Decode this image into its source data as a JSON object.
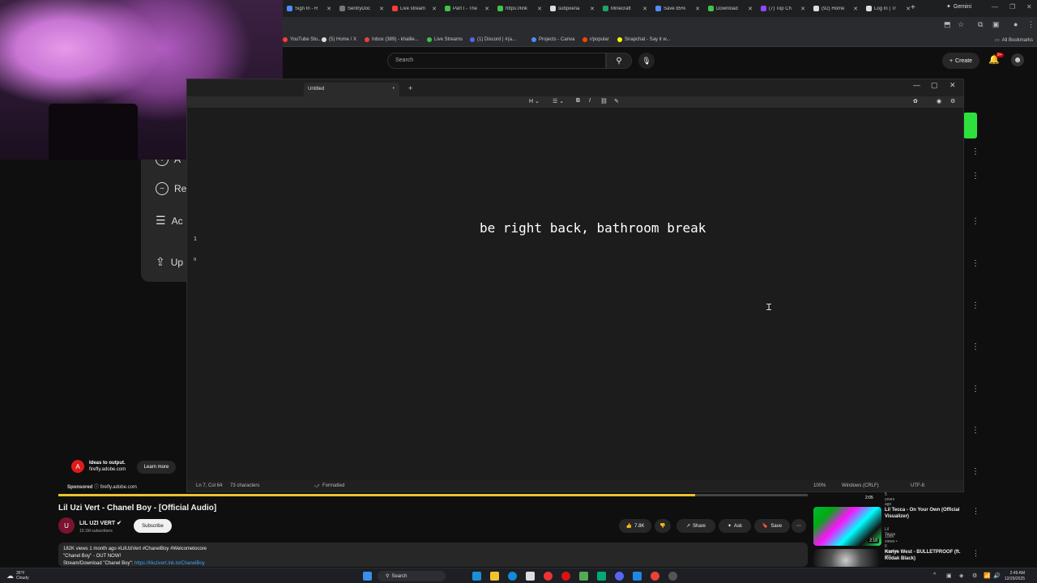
{
  "chrome": {
    "tabs": [
      {
        "label": "Sign In - R",
        "color": "#4f8cff"
      },
      {
        "label": "SentryDoc",
        "color": "#777777"
      },
      {
        "label": "Live stream",
        "color": "#ff3b3b"
      },
      {
        "label": "Part I - The",
        "color": "#3fc24a"
      },
      {
        "label": "https://link",
        "color": "#3fc24a"
      },
      {
        "label": "subpoena",
        "color": "#dddddd"
      },
      {
        "label": "Minecraft",
        "color": "#21a366"
      },
      {
        "label": "Save 85%",
        "color": "#4f8cff"
      },
      {
        "label": "Download",
        "color": "#3fc24a"
      },
      {
        "label": "(7) Top Ch",
        "color": "#9146ff"
      },
      {
        "label": "(92) Home",
        "color": "#dddddd"
      },
      {
        "label": "Log In | Tr",
        "color": "#dddddd"
      }
    ],
    "new_tab": "+",
    "gemini": "Gemini",
    "bookmarks": [
      {
        "label": "YouTube Stu...",
        "color": "#ff3b3b"
      },
      {
        "label": "(5) Home / X",
        "color": "#dddddd"
      },
      {
        "label": "Inbox (389) - khalile...",
        "color": "#ea4335"
      },
      {
        "label": "Live Streams",
        "color": "#3fc24a"
      },
      {
        "label": "(1) Discord | #(a...",
        "color": "#5865f2"
      },
      {
        "label": "Projects - Canva",
        "color": "#4f8cff"
      },
      {
        "label": "r/popular",
        "color": "#ff4500"
      },
      {
        "label": "Snapchat - Say it w...",
        "color": "#fffc00"
      }
    ],
    "all_bookmarks": "All Bookmarks"
  },
  "youtube": {
    "search_placeholder": "Search",
    "create_label": "Create",
    "notif_badge": "9+",
    "video_title": "Lil Uzi Vert - Chanel Boy - [Official Audio]",
    "channel_name": "LIL UZI VERT",
    "channel_subs": "10.1M subscribers",
    "subscribe_label": "Subscribe",
    "likes": "7.8K",
    "share_label": "Share",
    "ask_label": "Ask",
    "save_label": "Save",
    "description_line1": "182K views  1 month ago  #LilUziVert #ChanelBoy #Welcometocore",
    "description_line2": "\"Chanel Boy\" - OUT NOW!",
    "description_line3": "Stream/Download \"Chanel Boy\": ",
    "description_link": "https://liluzivert.lnk.to/ChanelBoy",
    "progress_fraction": 0.85,
    "ad": {
      "headline": "Ideas to output.",
      "domain": "firefly.adobe.com",
      "learn_more": "Learn more",
      "sponsored": "Sponsored",
      "sponsor_domain": "firefly.adobe.com"
    },
    "recommendations": [
      {
        "title": "Lil Tecca - On Your Own (Official Visualizer)",
        "channel": "Lil Tecca",
        "meta": "108K views • 6 months ago",
        "duration": "2:18"
      },
      {
        "title": "Kanye West - BULLETPROOF (ft. Kodak Black)",
        "channel": "",
        "meta": "",
        "duration": ""
      }
    ],
    "rec_top_meta": "5 years ago",
    "rec_top_duration": "2:05"
  },
  "context_menu": {
    "items": [
      {
        "label": "A",
        "icon": "plus-circle-icon"
      },
      {
        "label": "Re",
        "icon": "minus-circle-icon"
      },
      {
        "label": "Ac",
        "icon": "sliders-icon"
      },
      {
        "label": "Up",
        "icon": "upload-icon"
      }
    ]
  },
  "notepad": {
    "tab_title": "Untitled",
    "text": "be right back, bathroom break",
    "gutter_1": "1",
    "gutter_2": "¤",
    "status": {
      "position": "Ln 7, Col 64",
      "chars": "73 characters",
      "formatted": "Formatted",
      "zoom": "100%",
      "line_ending": "Windows (CRLF)",
      "encoding": "UTF-8"
    }
  },
  "taskbar": {
    "weather_temp": "35°F",
    "weather_desc": "Cloudy",
    "search_label": "Search",
    "time": "2:49 AM",
    "date": "12/29/2025"
  }
}
